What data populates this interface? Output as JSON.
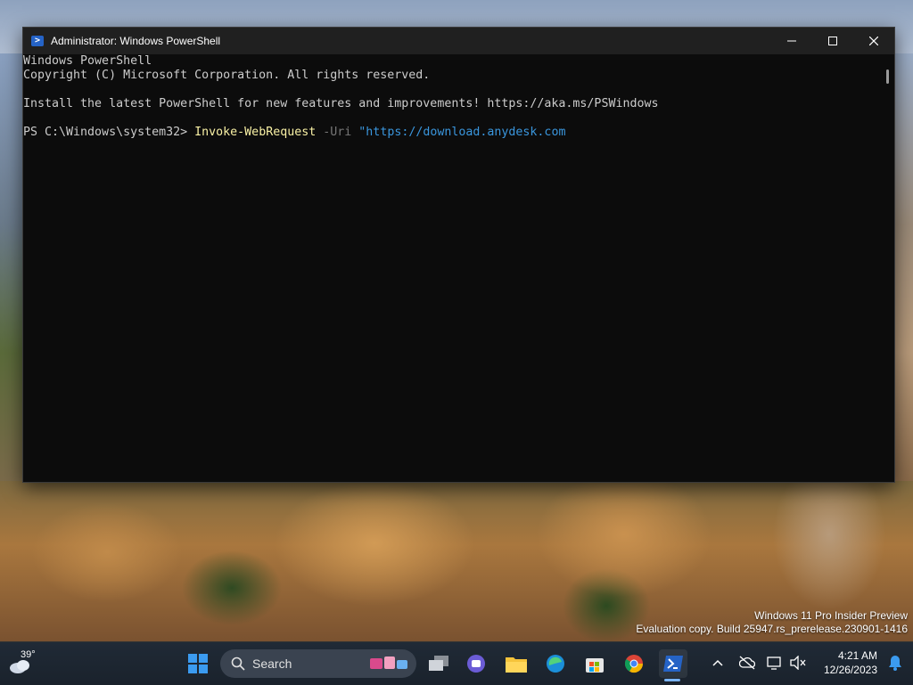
{
  "window": {
    "title": "Administrator: Windows PowerShell",
    "controls": {
      "minimize": "—",
      "maximize": "☐",
      "close": "✕"
    }
  },
  "console": {
    "line1": "Windows PowerShell",
    "line2": "Copyright (C) Microsoft Corporation. All rights reserved.",
    "line3": "Install the latest PowerShell for new features and improvements! https://aka.ms/PSWindows",
    "prompt": "PS C:\\Windows\\system32>",
    "command": "Invoke-WebRequest",
    "param": "-Uri",
    "string": "\"https://download.anydesk.com"
  },
  "watermark": {
    "line1": "Windows 11 Pro Insider Preview",
    "line2": "Evaluation copy. Build 25947.rs_prerelease.230901-1416"
  },
  "taskbar": {
    "weather_temp": "39°",
    "search_placeholder": "Search",
    "time": "4:21 AM",
    "date": "12/26/2023"
  },
  "colors": {
    "console_bg": "#0c0c0c",
    "command": "#f9f1a5",
    "param": "#767676",
    "string": "#3a96dd"
  }
}
